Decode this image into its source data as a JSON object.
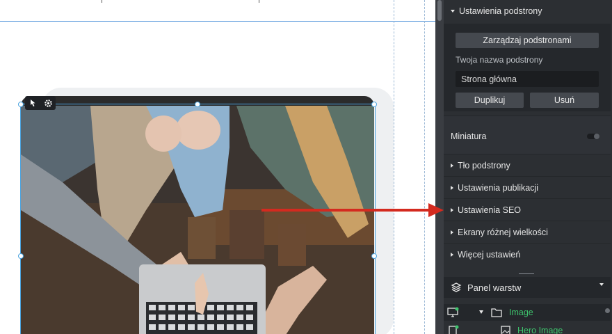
{
  "colors": {
    "accent": "#4aa3df",
    "layer_green": "#3ec46d",
    "arrow_red": "#d42a1f",
    "panel_bg": "#2c2f33"
  },
  "canvas": {
    "toolbar_icons": [
      "pointer-hand-icon",
      "gear-icon"
    ]
  },
  "panel": {
    "subpage_settings": {
      "title": "Ustawienia podstrony",
      "manage_button": "Zarządzaj podstronami",
      "name_label": "Twoja nazwa podstrony",
      "name_value": "Strona główna",
      "duplicate_button": "Duplikuj",
      "delete_button": "Usuń"
    },
    "thumbnail": {
      "label": "Miniatura",
      "enabled": false
    },
    "sections": [
      "Tło podstrony",
      "Ustawienia publikacji",
      "Ustawienia SEO",
      "Ekrany różnej wielkości",
      "Więcej ustawień"
    ],
    "layers": {
      "title": "Panel warstw",
      "items": [
        {
          "name": "Image",
          "icon": "folder-icon"
        },
        {
          "name": "Hero Image",
          "icon": "image-icon"
        }
      ]
    }
  }
}
